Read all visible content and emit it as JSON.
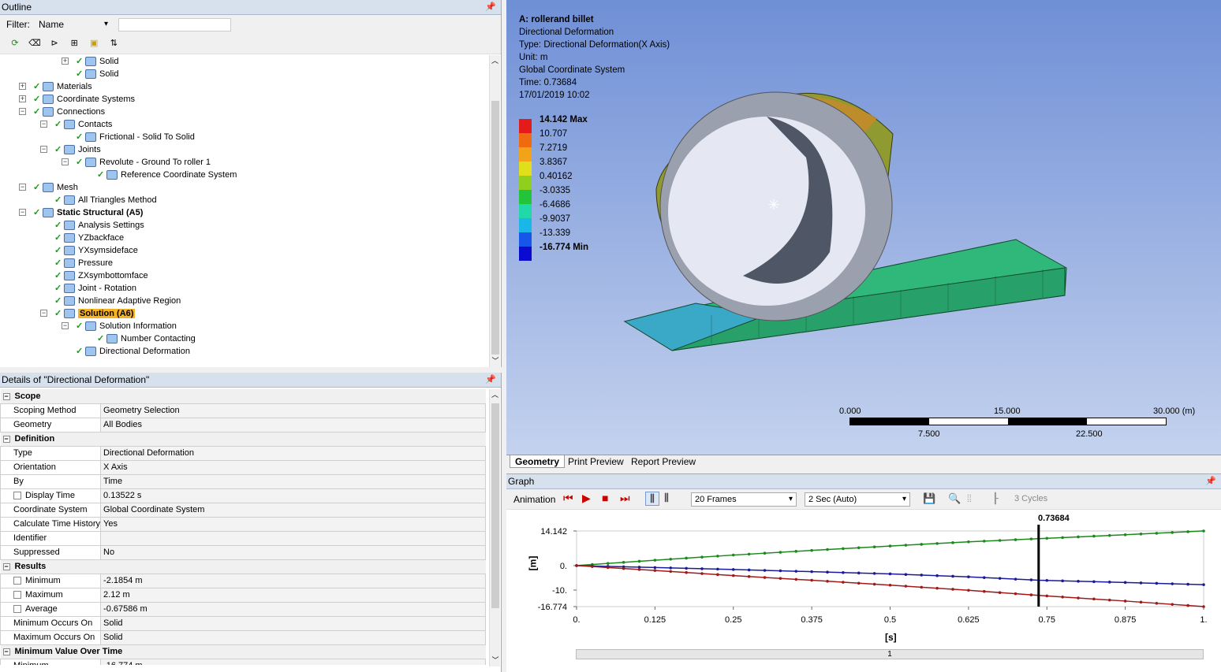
{
  "outline": {
    "title": "Outline",
    "filter_label": "Filter:",
    "filter_value": "Name",
    "tree": [
      {
        "label": "Solid",
        "indent": 4,
        "exp": "+"
      },
      {
        "label": "Solid",
        "indent": 4
      },
      {
        "label": "Materials",
        "indent": 2,
        "exp": "+"
      },
      {
        "label": "Coordinate Systems",
        "indent": 2,
        "exp": "+"
      },
      {
        "label": "Connections",
        "indent": 2,
        "exp": "-"
      },
      {
        "label": "Contacts",
        "indent": 3,
        "exp": "-"
      },
      {
        "label": "Frictional - Solid To Solid",
        "indent": 4
      },
      {
        "label": "Joints",
        "indent": 3,
        "exp": "-"
      },
      {
        "label": "Revolute - Ground To roller 1",
        "indent": 4,
        "exp": "-"
      },
      {
        "label": "Reference Coordinate System",
        "indent": 5
      },
      {
        "label": "Mesh",
        "indent": 2,
        "exp": "-"
      },
      {
        "label": "All Triangles Method",
        "indent": 3
      },
      {
        "label": "Static Structural (A5)",
        "indent": 2,
        "exp": "-",
        "bold": true
      },
      {
        "label": "Analysis Settings",
        "indent": 3
      },
      {
        "label": "YZbackface",
        "indent": 3
      },
      {
        "label": "YXsymsideface",
        "indent": 3
      },
      {
        "label": "Pressure",
        "indent": 3
      },
      {
        "label": "ZXsymbottomface",
        "indent": 3
      },
      {
        "label": "Joint - Rotation",
        "indent": 3
      },
      {
        "label": "Nonlinear Adaptive Region",
        "indent": 3
      },
      {
        "label": "Solution (A6)",
        "indent": 3,
        "exp": "-",
        "selected": true
      },
      {
        "label": "Solution Information",
        "indent": 4,
        "exp": "-"
      },
      {
        "label": "Number Contacting",
        "indent": 5
      },
      {
        "label": "Directional Deformation",
        "indent": 4
      }
    ]
  },
  "details": {
    "title": "Details of \"Directional Deformation\"",
    "rows": [
      {
        "group": "Scope"
      },
      {
        "k": "Scoping Method",
        "v": "Geometry Selection"
      },
      {
        "k": "Geometry",
        "v": "All Bodies"
      },
      {
        "group": "Definition"
      },
      {
        "k": "Type",
        "v": "Directional Deformation"
      },
      {
        "k": "Orientation",
        "v": "X Axis"
      },
      {
        "k": "By",
        "v": "Time"
      },
      {
        "k": "Display Time",
        "v": "0.13522 s",
        "cb": true
      },
      {
        "k": "Coordinate System",
        "v": "Global Coordinate System"
      },
      {
        "k": "Calculate Time History",
        "v": "Yes"
      },
      {
        "k": "Identifier",
        "v": ""
      },
      {
        "k": "Suppressed",
        "v": "No"
      },
      {
        "group": "Results"
      },
      {
        "k": "Minimum",
        "v": "-2.1854 m",
        "cb": true
      },
      {
        "k": "Maximum",
        "v": "2.12 m",
        "cb": true
      },
      {
        "k": "Average",
        "v": "-0.67586 m",
        "cb": true
      },
      {
        "k": "Minimum Occurs On",
        "v": "Solid"
      },
      {
        "k": "Maximum Occurs On",
        "v": "Solid"
      },
      {
        "group": "Minimum Value Over Time"
      },
      {
        "k": "Minimum",
        "v": "-16.774 m"
      }
    ]
  },
  "viewport": {
    "info": [
      "A: rollerand billet",
      "Directional Deformation",
      "Type: Directional Deformation(X Axis)",
      "Unit: m",
      "Global Coordinate System",
      "Time: 0.73684",
      "17/01/2019 10:02"
    ],
    "legend": [
      {
        "label": "14.142 Max",
        "color": "#e31b1b",
        "bold": true
      },
      {
        "label": "10.707",
        "color": "#f06a10"
      },
      {
        "label": "7.2719",
        "color": "#f2a317"
      },
      {
        "label": "3.8367",
        "color": "#e0e01a"
      },
      {
        "label": "0.40162",
        "color": "#8fd01e"
      },
      {
        "label": "-3.0335",
        "color": "#22c43a"
      },
      {
        "label": "-6.4686",
        "color": "#20d8a8"
      },
      {
        "label": "-9.9037",
        "color": "#1ab6e8"
      },
      {
        "label": "-13.339",
        "color": "#1656e8"
      },
      {
        "label": "-16.774 Min",
        "color": "#0a0ad0",
        "bold": true
      }
    ],
    "scale_top": [
      "0.000",
      "15.000",
      "30.000 (m)"
    ],
    "scale_bottom": [
      "7.500",
      "22.500"
    ],
    "tabs": [
      "Geometry",
      "Print Preview",
      "Report Preview"
    ]
  },
  "graph": {
    "title": "Graph",
    "animation_label": "Animation",
    "frames": "20 Frames",
    "duration": "2 Sec (Auto)",
    "cycles": "3 Cycles",
    "marker": "0.73684",
    "xlabel": "[s]",
    "ylabel": "[m]",
    "slider_value": "1"
  },
  "chart_data": {
    "type": "line",
    "xlabel": "[s]",
    "ylabel": "[m]",
    "xlim": [
      0,
      1
    ],
    "ylim": [
      -16.774,
      14.142
    ],
    "yticks": [
      "14.142",
      "0.",
      "-10.",
      "-16.774"
    ],
    "xticks": [
      "0.",
      "0.125",
      "0.25",
      "0.375",
      "0.5",
      "0.625",
      "0.75",
      "0.875",
      "1."
    ],
    "series": [
      {
        "color": "#1a8a1a",
        "x": [
          0,
          0.125,
          0.25,
          0.375,
          0.5,
          0.625,
          0.73684,
          0.875,
          1
        ],
        "y": [
          0,
          2.2,
          4.3,
          6.2,
          8.0,
          9.7,
          11.0,
          12.6,
          14.142
        ]
      },
      {
        "color": "#1a1a9a",
        "x": [
          0,
          0.125,
          0.25,
          0.375,
          0.5,
          0.625,
          0.73684,
          0.875,
          1
        ],
        "y": [
          0,
          -0.8,
          -1.6,
          -2.5,
          -3.4,
          -4.6,
          -6.0,
          -6.9,
          -7.8
        ]
      },
      {
        "color": "#a01a1a",
        "x": [
          0,
          0.125,
          0.25,
          0.375,
          0.5,
          0.625,
          0.73684,
          0.875,
          1
        ],
        "y": [
          0,
          -2.0,
          -4.1,
          -6.0,
          -8.0,
          -10.1,
          -12.2,
          -14.5,
          -16.774
        ]
      }
    ]
  }
}
